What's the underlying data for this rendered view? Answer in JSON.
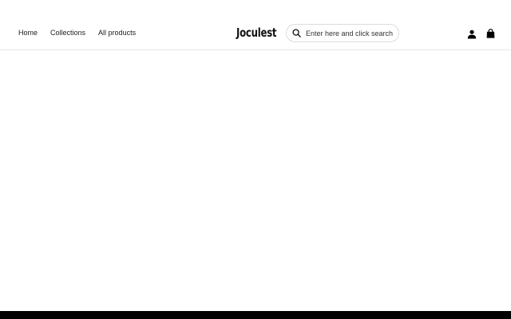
{
  "header": {
    "nav": [
      {
        "label": "Home"
      },
      {
        "label": "Collections"
      },
      {
        "label": "All products"
      }
    ],
    "logo_text": "Joculest",
    "search": {
      "placeholder": "Enter here and click search",
      "value": "",
      "icon": "search-icon"
    },
    "icons": {
      "account": "user-icon",
      "cart": "shopping-bag-icon"
    }
  },
  "colors": {
    "background": "#ffffff",
    "text": "#111111",
    "divider": "#e8e8e8",
    "footer": "#000000"
  }
}
